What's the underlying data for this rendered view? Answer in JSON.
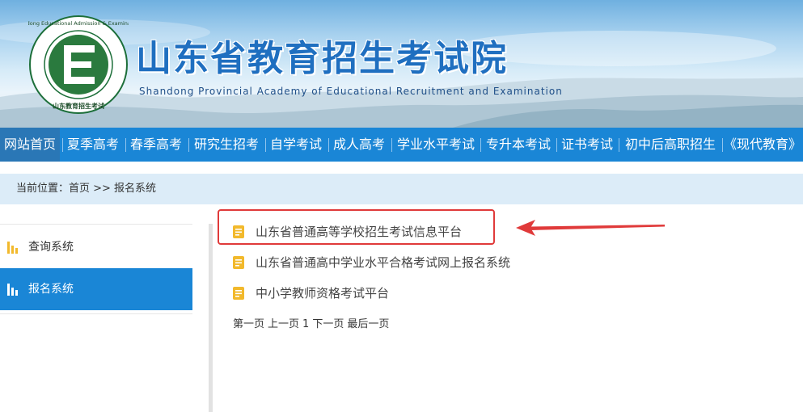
{
  "header": {
    "title": "山东省教育招生考试院",
    "subtitle": "Shandong Provincial Academy of Educational Recruitment and Examination",
    "logo": {
      "ring_text": "Shandong Educational Admission & Examinations",
      "bottom_text": "山东教育招生考试"
    }
  },
  "nav": {
    "items": [
      {
        "label": "网站首页",
        "active": true
      },
      {
        "label": "夏季高考"
      },
      {
        "label": "春季高考"
      },
      {
        "label": "研究生招考"
      },
      {
        "label": "自学考试"
      },
      {
        "label": "成人高考"
      },
      {
        "label": "学业水平考试"
      },
      {
        "label": "专升本考试"
      },
      {
        "label": "证书考试"
      },
      {
        "label": "初中后高职招生"
      },
      {
        "label": "《现代教育》"
      }
    ]
  },
  "breadcrumb": {
    "text": "当前位置：首页 >> 报名系统"
  },
  "sidebar": {
    "items": [
      {
        "label": "查询系统",
        "icon": "bar-chart-icon",
        "active": false
      },
      {
        "label": "报名系统",
        "icon": "bar-chart-icon",
        "active": true
      }
    ]
  },
  "content": {
    "list": [
      {
        "label": "山东省普通高等学校招生考试信息平台",
        "icon": "document-icon",
        "highlighted": true
      },
      {
        "label": "山东省普通高中学业水平合格考试网上报名系统",
        "icon": "document-icon"
      },
      {
        "label": "中小学教师资格考试平台",
        "icon": "document-icon"
      }
    ],
    "pager": {
      "first": "第一页",
      "prev": "上一页",
      "current": "1",
      "next": "下一页",
      "last": "最后一页"
    }
  },
  "colors": {
    "nav_bg": "#1a86d6",
    "nav_active": "#2a77b6",
    "breadcrumb_bg": "#dcecf8",
    "doc_icon": "#f2b92c",
    "annotation": "#e03a3a"
  }
}
